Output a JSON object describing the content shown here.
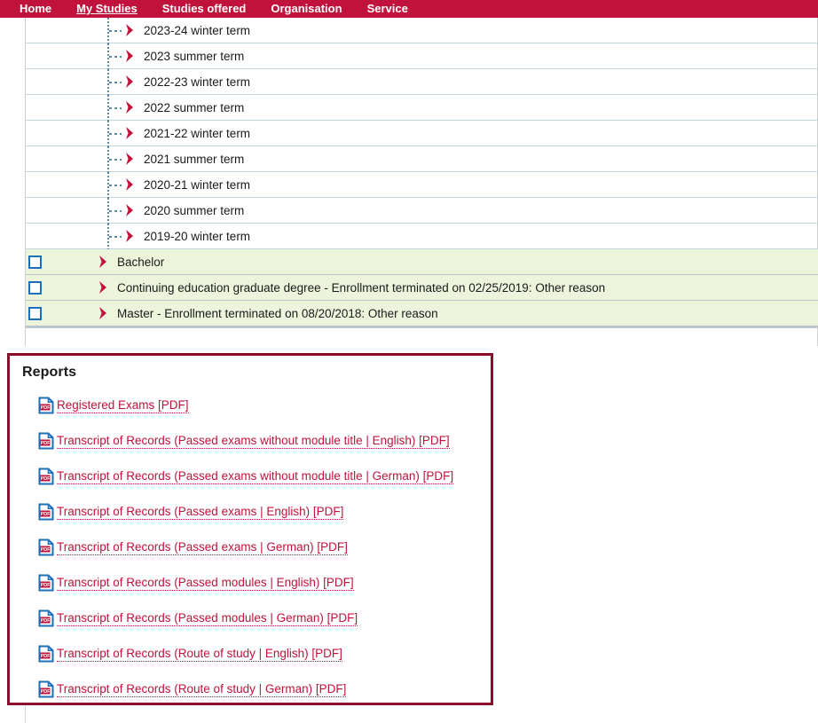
{
  "nav": {
    "items": [
      {
        "label": "Home",
        "active": false
      },
      {
        "label": "My Studies",
        "active": true
      },
      {
        "label": "Studies offered",
        "active": false
      },
      {
        "label": "Organisation",
        "active": false
      },
      {
        "label": "Service",
        "active": false
      }
    ]
  },
  "tree": {
    "terms": [
      {
        "label": "2023-24 winter term"
      },
      {
        "label": "2023 summer term"
      },
      {
        "label": "2022-23 winter term"
      },
      {
        "label": "2022 summer term"
      },
      {
        "label": "2021-22 winter term"
      },
      {
        "label": "2021 summer term"
      },
      {
        "label": "2020-21 winter term"
      },
      {
        "label": "2020 summer term"
      },
      {
        "label": "2019-20 winter term"
      }
    ],
    "degrees": [
      {
        "label": "Bachelor",
        "checked": false
      },
      {
        "label": "Continuing education graduate degree - Enrollment terminated on 02/25/2019: Other reason",
        "checked": false
      },
      {
        "label": "Master - Enrollment terminated on 08/20/2018: Other reason",
        "checked": false
      }
    ]
  },
  "reports": {
    "title": "Reports",
    "links": [
      {
        "label": "Registered Exams [PDF]",
        "icon": "pdf-icon"
      },
      {
        "label": "Transcript of Records (Passed exams without module title | English) [PDF]",
        "icon": "pdf-icon"
      },
      {
        "label": "Transcript of Records (Passed exams without module title | German) [PDF]",
        "icon": "pdf-icon"
      },
      {
        "label": "Transcript of Records (Passed exams | English) [PDF]",
        "icon": "pdf-icon"
      },
      {
        "label": "Transcript of Records (Passed exams | German) [PDF]",
        "icon": "pdf-icon"
      },
      {
        "label": "Transcript of Records (Passed modules | English) [PDF]",
        "icon": "pdf-icon"
      },
      {
        "label": "Transcript of Records (Passed modules | German) [PDF]",
        "icon": "pdf-icon"
      },
      {
        "label": "Transcript of Records (Route of study | English) [PDF]",
        "icon": "pdf-icon"
      },
      {
        "label": "Transcript of Records (Route of study | German) [PDF]",
        "icon": "pdf-icon"
      }
    ]
  },
  "colors": {
    "nav_bar": "#C1123C",
    "link": "#C1123C",
    "panel_border": "#8C0E2B",
    "row_highlight": "#EDF4DC",
    "row_separator": "#C5D5DD",
    "checkbox_border": "#1D6FB8",
    "arrow": "#C1123C"
  }
}
